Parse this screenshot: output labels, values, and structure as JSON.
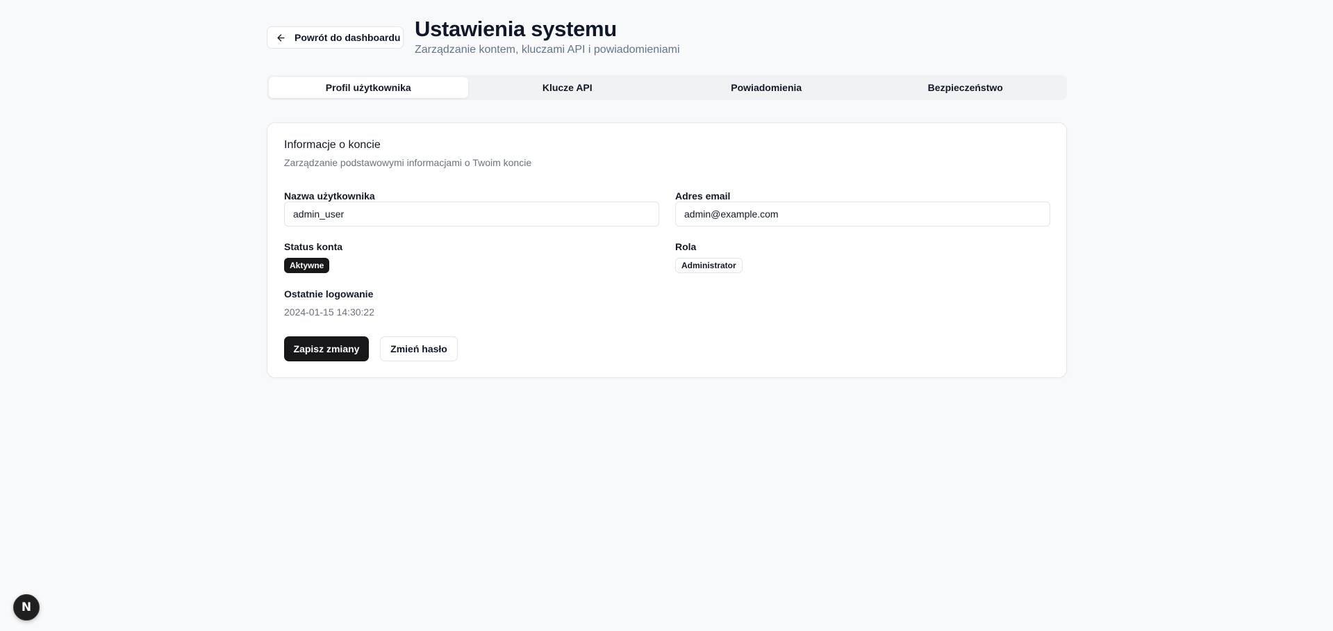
{
  "header": {
    "back_label": "Powrót do dashboardu",
    "title": "Ustawienia systemu",
    "subtitle": "Zarządzanie kontem, kluczami API i powiadomieniami"
  },
  "tabs": [
    {
      "label": "Profil użytkownika",
      "active": true
    },
    {
      "label": "Klucze API",
      "active": false
    },
    {
      "label": "Powiadomienia",
      "active": false
    },
    {
      "label": "Bezpieczeństwo",
      "active": false
    }
  ],
  "card": {
    "title": "Informacje o koncie",
    "description": "Zarządzanie podstawowymi informacjami o Twoim koncie",
    "username": {
      "label": "Nazwa użytkownika",
      "value": "admin_user"
    },
    "email": {
      "label": "Adres email",
      "value": "admin@example.com"
    },
    "status": {
      "label": "Status konta",
      "value": "Aktywne"
    },
    "role": {
      "label": "Rola",
      "value": "Administrator"
    },
    "last_login": {
      "label": "Ostatnie logowanie",
      "value": "2024-01-15 14:30:22"
    },
    "save_label": "Zapisz zmiany",
    "change_password_label": "Zmień hasło"
  },
  "next_badge": {
    "letter": "N"
  },
  "icons": {
    "back": "arrow-left-icon"
  },
  "colors": {
    "primary": "#18181b",
    "background": "#f8f9fb",
    "muted_text": "#6b7280"
  }
}
